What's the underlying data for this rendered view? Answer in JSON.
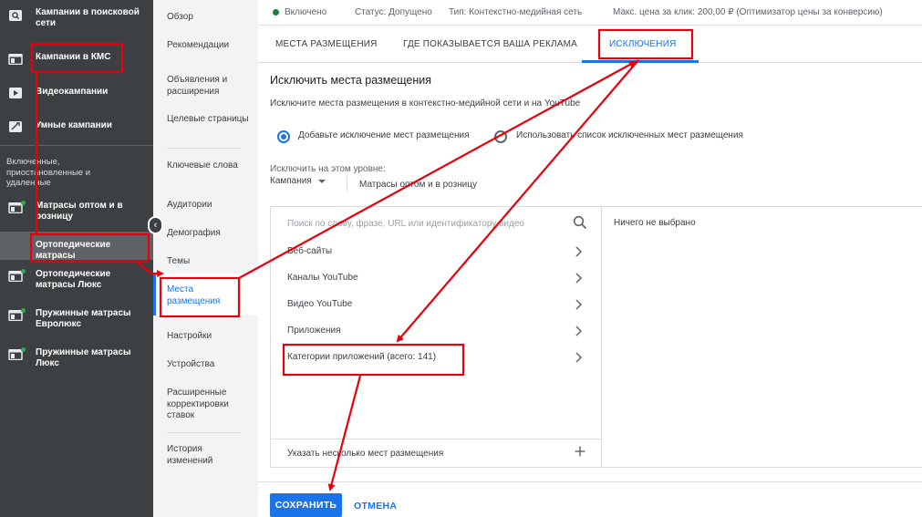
{
  "left_nav": {
    "items": [
      {
        "label": "Кампании в поисковой сети",
        "icon": "search-campaign-icon"
      },
      {
        "label": "Кампании в КМС",
        "icon": "display-campaign-icon"
      },
      {
        "label": "Видеокампании",
        "icon": "video-campaign-icon"
      },
      {
        "label": "Умные кампании",
        "icon": "smart-campaign-icon"
      }
    ],
    "section_label": "Включенные, приостановленные и удаленные",
    "campaigns": [
      {
        "label": "Матрасы оптом и в розницу",
        "status": "enabled"
      },
      {
        "label": "Ортопедические матрасы",
        "selected": true
      },
      {
        "label": "Ортопедические матрасы Люкс",
        "status": "enabled"
      },
      {
        "label": "Пружинные матрасы Евролюкс",
        "status": "enabled"
      },
      {
        "label": "Пружинные матрасы Люкс",
        "status": "enabled"
      }
    ]
  },
  "page_menu": {
    "items": [
      {
        "label": "Обзор"
      },
      {
        "label": "Рекомендации"
      },
      {
        "label": "Объявления и расширения"
      },
      {
        "label": "Целевые страницы"
      },
      {
        "label": "Ключевые слова"
      },
      {
        "label": "Аудитории"
      },
      {
        "label": "Демография"
      },
      {
        "label": "Темы"
      },
      {
        "label": "Места размещения",
        "active": true
      },
      {
        "label": "Настройки"
      },
      {
        "label": "Устройства"
      },
      {
        "label": "Расширенные корректировки ставок"
      },
      {
        "label": "История изменений"
      }
    ]
  },
  "status_bar": {
    "state": "Включено",
    "status": "Статус: Допущено",
    "type": "Тип: Контекстно-медийная сеть",
    "max_cpc": "Макс. цена за клик: 200,00 ₽ (Оптимизатор цены за конверсию)"
  },
  "tabs": [
    {
      "label": "МЕСТА РАЗМЕЩЕНИЯ"
    },
    {
      "label": "ГДЕ ПОКАЗЫВАЕТСЯ ВАША РЕКЛАМА"
    },
    {
      "label": "ИСКЛЮЧЕНИЯ",
      "active": true
    }
  ],
  "main": {
    "title": "Исключить места размещения",
    "description": "Исключите места размещения в контекстно-медийной сети и на YouTube",
    "radio_add": "Добавьте исключение мест размещения",
    "radio_list": "Использовать список исключенных мест размещения",
    "level_label": "Исключить на этом уровне:",
    "level_value": "Кампания",
    "level_campaign": "Матрасы оптом и в розницу",
    "search_placeholder": "Поиск по слову, фразе, URL или идентификатору видео",
    "categories": [
      {
        "label": "Веб-сайты"
      },
      {
        "label": "Каналы YouTube"
      },
      {
        "label": "Видео YouTube"
      },
      {
        "label": "Приложения"
      },
      {
        "label": "Категории приложений (всего: 141)"
      }
    ],
    "selected_placeholder": "Ничего не выбрано",
    "multi_label": "Указать несколько мест размещения",
    "save_label": "СОХРАНИТЬ",
    "cancel_label": "ОТМЕНА"
  },
  "annotation_color": "#e8000b",
  "colors": {
    "accent": "#1a73e8",
    "sidebar": "#3c4043",
    "menu_bg": "#f1f3f4",
    "enabled_green": "#34a853"
  }
}
